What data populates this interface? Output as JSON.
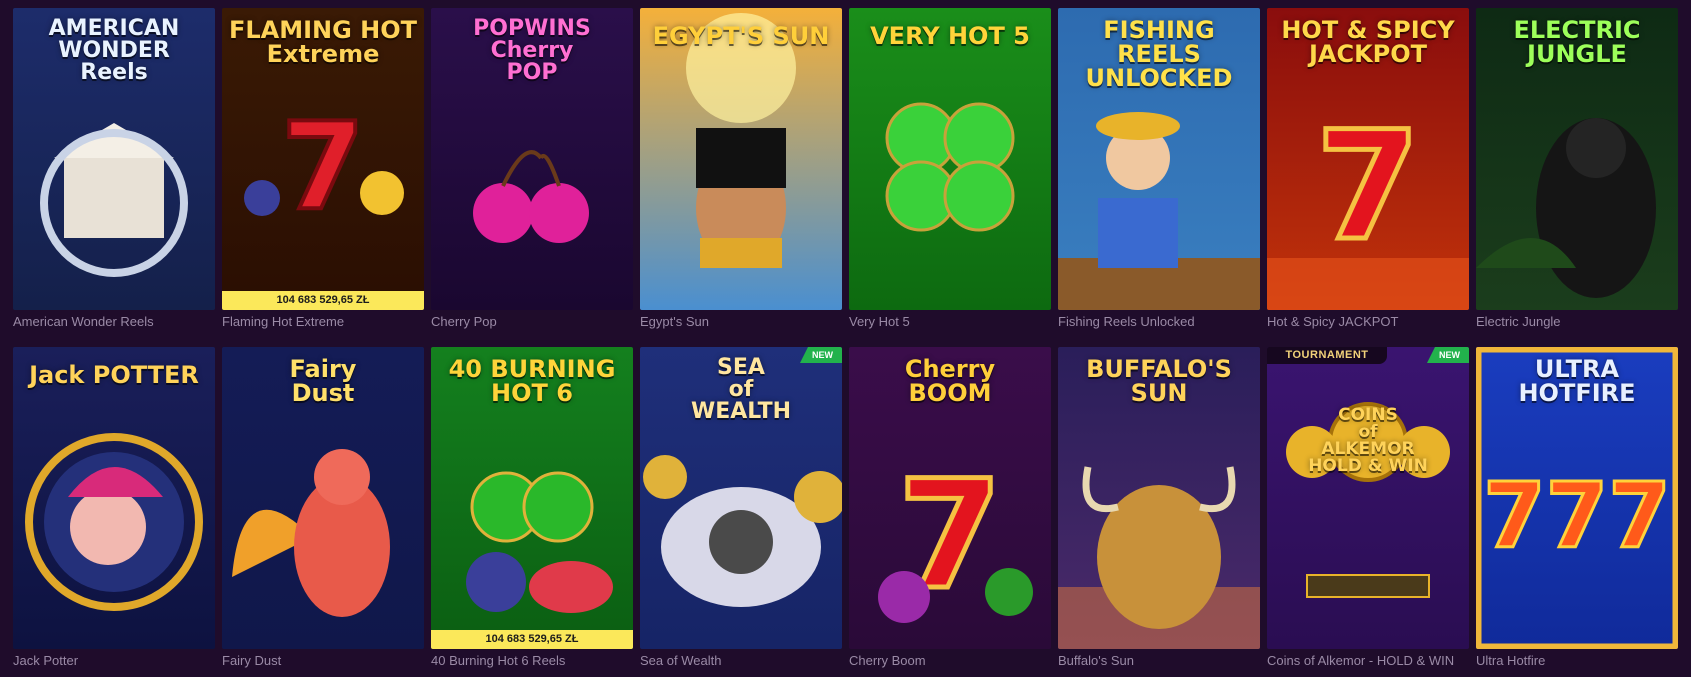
{
  "badges": {
    "new": "NEW",
    "tournament": "TOURNAMENT"
  },
  "games": [
    {
      "name": "American Wonder Reels",
      "logo": "AMERICAN\nWONDER\nReels",
      "logo_color": "#e9f3ff",
      "bg_top": "#1d2c6b",
      "bg_bottom": "#14204a"
    },
    {
      "name": "Flaming Hot Extreme",
      "logo": "FLAMING HOT\nExtreme",
      "logo_color": "#ffd35a",
      "bg_top": "#3a1a05",
      "bg_bottom": "#2a0e02",
      "jackpot": "104 683 529,65 ZŁ"
    },
    {
      "name": "Cherry Pop",
      "logo": "POPWINS\nCherry\nPOP",
      "logo_color": "#ff6fd2",
      "bg_top": "#2a0f4a",
      "bg_bottom": "#1a0730"
    },
    {
      "name": "Egypt's Sun",
      "logo": "EGYPT'S SUN",
      "logo_color": "#ffcf3a",
      "bg_top": "#f4b03a",
      "bg_bottom": "#4a8fd0"
    },
    {
      "name": "Very Hot 5",
      "logo": "VERY HOT 5",
      "logo_color": "#ffd43a",
      "bg_top": "#1a8e1a",
      "bg_bottom": "#0d6a10"
    },
    {
      "name": "Fishing Reels Unlocked",
      "logo": "FISHING REELS\nUNLOCKED",
      "logo_color": "#ffe14a",
      "bg_top": "#2d6bb0",
      "bg_bottom": "#3a7fc0"
    },
    {
      "name": "Hot & Spicy JACKPOT",
      "logo": "HOT & SPICY\nJACKPOT",
      "logo_color": "#ffd84a",
      "bg_top": "#8a0d0d",
      "bg_bottom": "#c2330a"
    },
    {
      "name": "Electric Jungle",
      "logo": "ELECTRIC\nJUNGLE",
      "logo_color": "#9dff5a",
      "bg_top": "#0e2a14",
      "bg_bottom": "#1b3d1c"
    },
    {
      "name": "Jack Potter",
      "logo": "Jack POTTER",
      "logo_color": "#ffd35a",
      "bg_top": "#1a1f5a",
      "bg_bottom": "#0d1240"
    },
    {
      "name": "Fairy Dust",
      "logo": "Fairy\nDust",
      "logo_color": "#ffe06a",
      "bg_top": "#141c56",
      "bg_bottom": "#10174a"
    },
    {
      "name": "40 Burning Hot 6 Reels",
      "logo": "40 BURNING\nHOT 6",
      "logo_color": "#ffd43a",
      "bg_top": "#14801e",
      "bg_bottom": "#0b5e12",
      "jackpot": "104 683 529,65 ZŁ"
    },
    {
      "name": "Sea of Wealth",
      "logo": "SEA\nof\nWEALTH",
      "logo_color": "#ffe6a0",
      "bg_top": "#1f2f7a",
      "bg_bottom": "#162466",
      "new": true
    },
    {
      "name": "Cherry Boom",
      "logo": "Cherry\nBOOM",
      "logo_color": "#ffcf3a",
      "bg_top": "#3a0d4a",
      "bg_bottom": "#2a0a38"
    },
    {
      "name": "Buffalo's Sun",
      "logo": "BUFFALO'S\nSUN",
      "logo_color": "#ffd35a",
      "bg_top": "#2a1e5a",
      "bg_bottom": "#4b2a6a"
    },
    {
      "name": "Coins of Alkemor - HOLD & WIN",
      "logo": "COINS\nof\nALKEMOR\nHOLD & WIN",
      "logo_color": "#ffd35a",
      "bg_top": "#3a1470",
      "bg_bottom": "#2a0d52",
      "new": true,
      "tournament": true
    },
    {
      "name": "Ultra Hotfire",
      "logo": "ULTRA\nHOTFIRE",
      "logo_color": "#e8f0ff",
      "bg_top": "#1a3dbf",
      "bg_bottom": "#102a9a",
      "selected": true
    }
  ]
}
